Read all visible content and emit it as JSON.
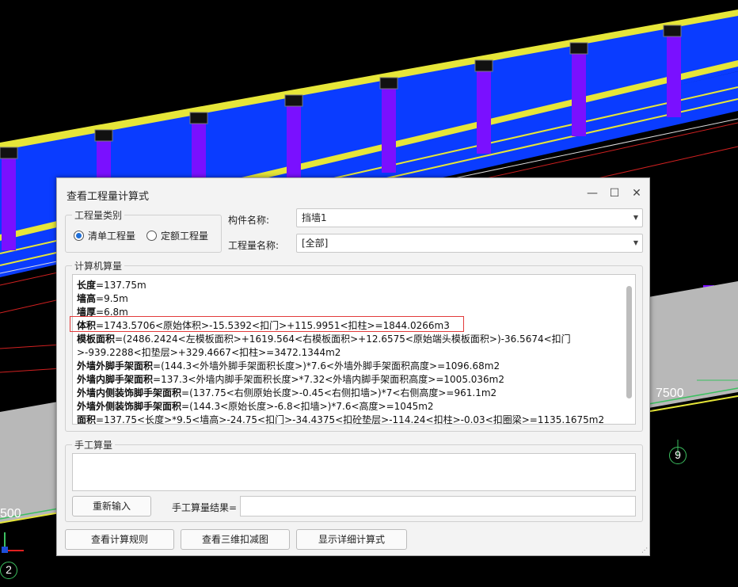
{
  "scene": {
    "dim_left": "7500",
    "dim_bottom_left": "500",
    "axis_right": "9",
    "axis_bottom": "2"
  },
  "dialog": {
    "title": "查看工程量计算式",
    "category_group": "工程量类别",
    "radio_list": "清单工程量",
    "radio_quota": "定额工程量",
    "component_label": "构件名称:",
    "component_value": "挡墙1",
    "qty_label": "工程量名称:",
    "qty_value": "[全部]",
    "calc_group": "计算机算量",
    "calc_lines": [
      {
        "name": "长度",
        "expr": "=137.75m"
      },
      {
        "name": "墙高",
        "expr": "=9.5m"
      },
      {
        "name": "墙厚",
        "expr": "=6.8m"
      },
      {
        "name": "体积",
        "expr": "=1743.5706<原始体积>-15.5392<扣门>+115.9951<扣柱>=1844.0266m3"
      },
      {
        "name": "模板面积",
        "expr": "=(2486.2424<左模板面积>+1619.564<右模板面积>+12.6575<原始端头模板面积>)-36.5674<扣门>-939.2288<扣垫层>+329.4667<扣柱>=3472.1344m2"
      },
      {
        "name": "外墙外脚手架面积",
        "expr": "=(144.3<外墙外脚手架面积长度>)*7.6<外墙外脚手架面积高度>=1096.68m2"
      },
      {
        "name": "外墙内脚手架面积",
        "expr": "=137.3<外墙内脚手架面积长度>*7.32<外墙内脚手架面积高度>=1005.036m2"
      },
      {
        "name": "外墙内侧装饰脚手架面积",
        "expr": "=(137.75<右侧原始长度>-0.45<右侧扣墙>)*7<右侧高度>=961.1m2"
      },
      {
        "name": "外墙外侧装饰脚手架面积",
        "expr": "=(144.3<原始长度>-6.8<扣墙>)*7.6<高度>=1045m2"
      },
      {
        "name": "面积",
        "expr": "=137.75<长度>*9.5<墙高>-24.75<扣门>-34.4375<扣砼垫层>-114.24<扣柱>-0.03<扣圈梁>=1135.1675m2"
      }
    ],
    "manual_group": "手工算量",
    "reinput_button": "重新输入",
    "manual_result_label": "手工算量结果=",
    "btn_rules": "查看计算规则",
    "btn_3d": "查看三维扣减图",
    "btn_detail": "显示详细计算式"
  }
}
